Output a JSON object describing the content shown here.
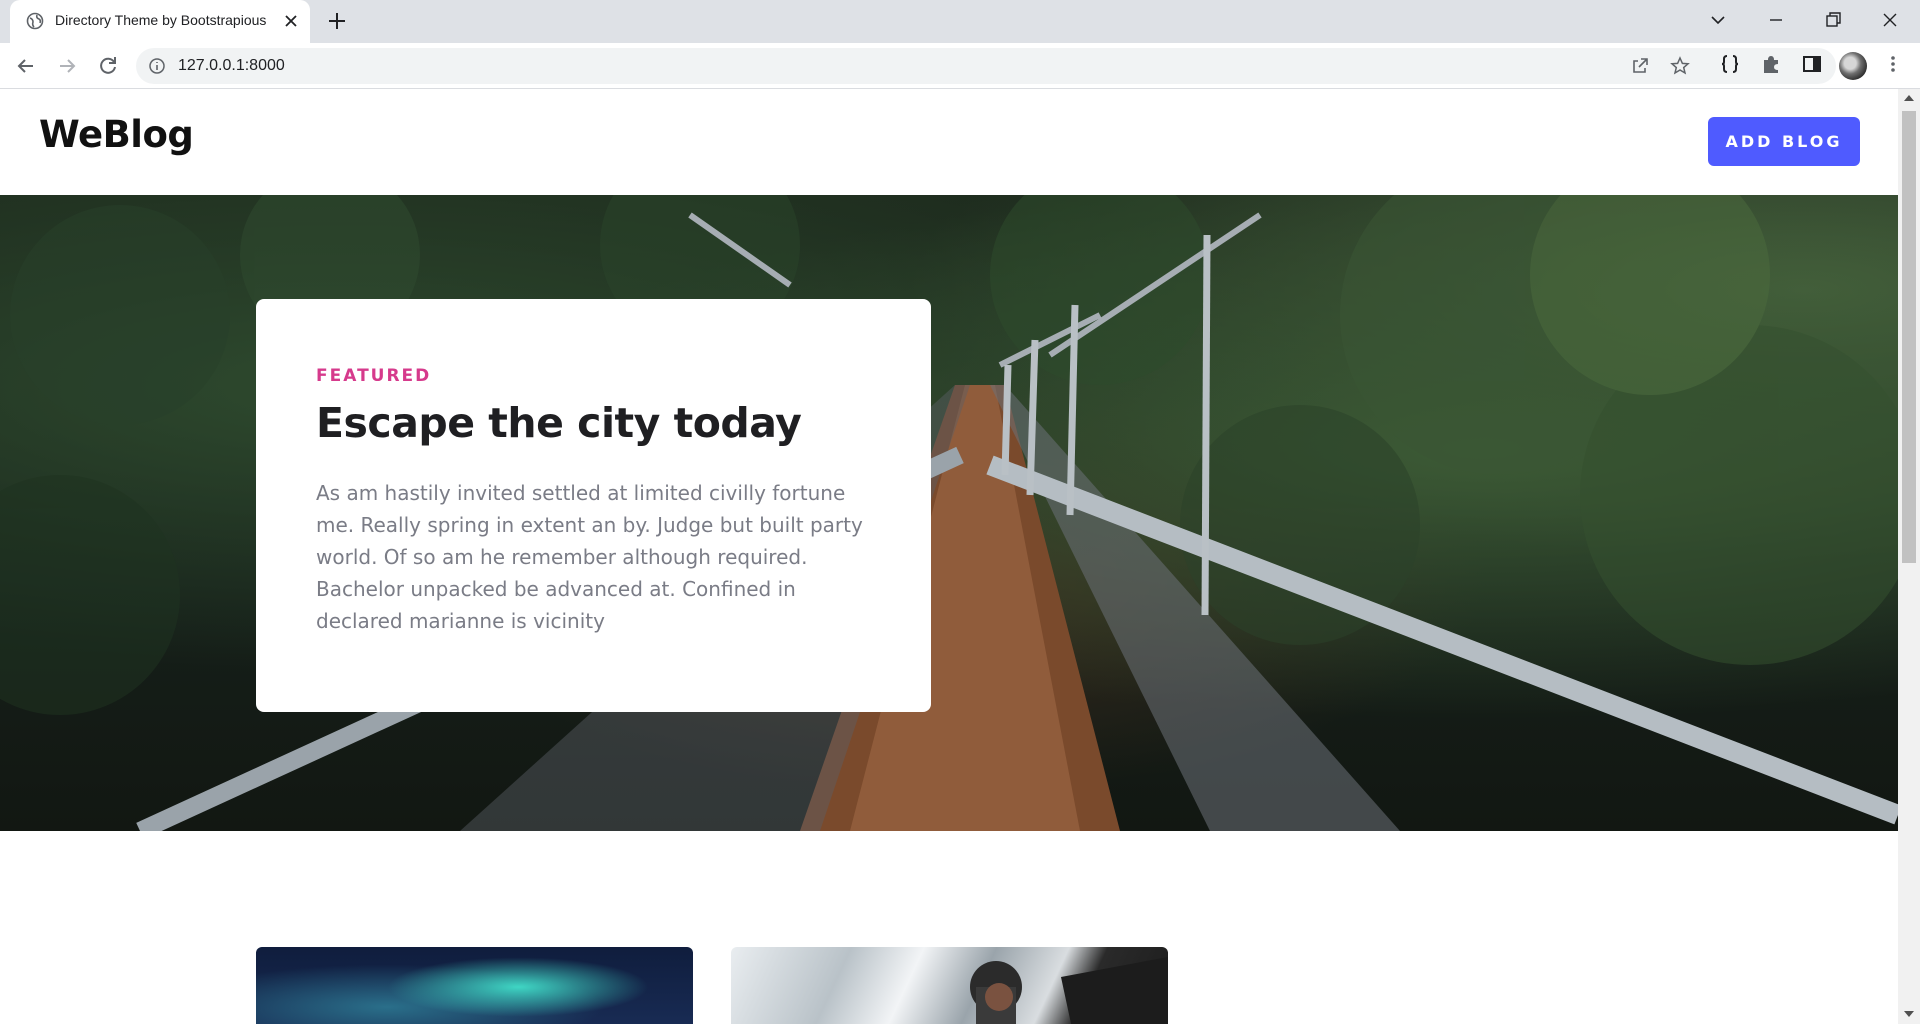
{
  "browser": {
    "tab_title": "Directory Theme by Bootstrapious",
    "url": "127.0.0.1:8000",
    "icons": [
      "globe-icon",
      "close-icon",
      "plus-icon",
      "chevron-down-icon",
      "minimize-icon",
      "restore-icon",
      "window-close-icon",
      "back-icon",
      "forward-icon",
      "reload-icon",
      "info-icon",
      "share-icon",
      "star-icon",
      "braces-icon",
      "puzzle-icon",
      "sidepanel-icon",
      "more-icon"
    ]
  },
  "header": {
    "logo": "WeBlog",
    "add_button": "ADD BLOG"
  },
  "featured": {
    "kicker": "FEATURED",
    "title": "Escape the city today",
    "body": "As am hastily invited settled at limited civilly fortune me. Really spring in extent an by. Judge but built party world. Of so am he remember although required. Bachelor unpacked be advanced at. Confined in declared marianne is vicinity"
  },
  "colors": {
    "accent": "#4f5bff",
    "kicker": "#d63a8c",
    "title": "#1f1f22",
    "body": "#7a7c86"
  }
}
